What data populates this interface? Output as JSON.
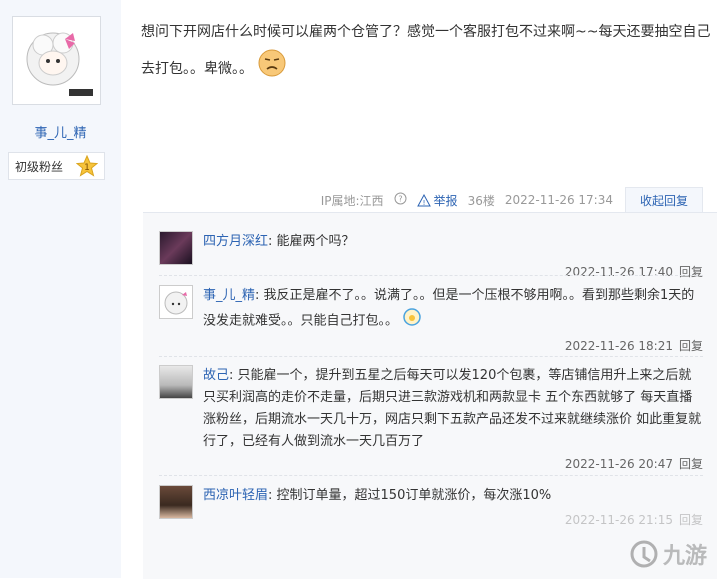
{
  "author": {
    "name": "事_儿_精",
    "level_label": "初级粉丝",
    "level_number": "1"
  },
  "post": {
    "text": "想问下开网店什么时候可以雇两个仓管了？感觉一个客服打包不过来啊~~每天还要抽空自己去打包。。卑微。。"
  },
  "meta": {
    "ip": "IP属地:江西",
    "report": "举报",
    "floor": "36楼",
    "time": "2022-11-26 17:34",
    "reply_toggle": "收起回复"
  },
  "comments": [
    {
      "user": "四方月深红",
      "text": "能雇两个吗？",
      "time": "2022-11-26 17:40",
      "reply": "回复"
    },
    {
      "user": "事_儿_精",
      "text": "我反正是雇不了。。说满了。。但是一个压根不够用啊。。看到那些剩余1天的没发走就难受。。只能自己打包。。",
      "time": "2022-11-26 18:21",
      "reply": "回复"
    },
    {
      "user": "故己",
      "text": "只能雇一个，提升到五星之后每天可以发120个包裹，等店铺信用升上来之后就只买利润高的走价不走量，后期只进三款游戏机和两款显卡 五个东西就够了 每天直播涨粉丝，后期流水一天几十万，网店只剩下五款产品还发不过来就继续涨价 如此重复就行了，已经有人做到流水一天几百万了",
      "time": "2022-11-26 20:47",
      "reply": "回复"
    },
    {
      "user": "西凉叶轻眉",
      "text": "控制订单量，超过150订单就涨价，每次涨10%",
      "time": "2022-11-26 21:15",
      "reply": "回复"
    }
  ],
  "watermark": "九游"
}
